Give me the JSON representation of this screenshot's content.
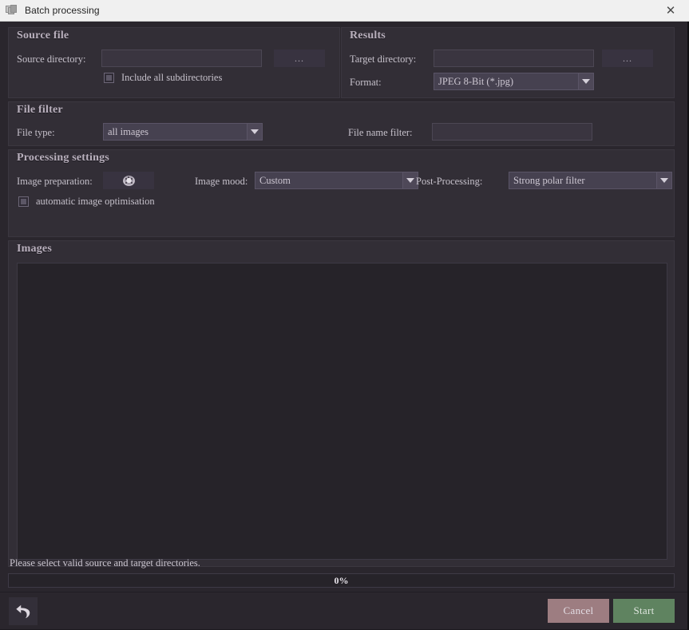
{
  "window": {
    "title": "Batch processing",
    "icon": "layers-icon",
    "close_label": "✕"
  },
  "source_file": {
    "title": "Source file",
    "source_directory_label": "Source directory:",
    "source_directory_value": "",
    "browse_label": "...",
    "include_subdirectories_label": "Include all subdirectories",
    "include_subdirectories_checked": false
  },
  "results": {
    "title": "Results",
    "target_directory_label": "Target directory:",
    "target_directory_value": "",
    "browse_label": "...",
    "format_label": "Format:",
    "format_value": "JPEG 8-Bit (*.jpg)"
  },
  "file_filter": {
    "title": "File filter",
    "file_type_label": "File type:",
    "file_type_value": "all images",
    "file_name_filter_label": "File name filter:",
    "file_name_filter_value": ""
  },
  "processing_settings": {
    "title": "Processing settings",
    "image_preparation_label": "Image preparation:",
    "image_preparation_icon": "gear-icon",
    "automatic_optimisation_label": "automatic image optimisation",
    "automatic_optimisation_checked": false,
    "image_mood_label": "Image mood:",
    "image_mood_value": "Custom",
    "post_processing_label": "Post-Processing:",
    "post_processing_value": "Strong polar filter"
  },
  "images": {
    "title": "Images",
    "items": []
  },
  "status": {
    "message": "Please select valid source and target directories.",
    "progress_percent": "0%"
  },
  "footer": {
    "back_icon": "undo-arrow-icon",
    "cancel_label": "Cancel",
    "start_label": "Start"
  },
  "colors": {
    "window_background": "#2a262d",
    "panel_background": "#322e36",
    "titlebar_background": "#f0f0f0",
    "cancel_button": "#9d7d81",
    "start_button": "#5f8360",
    "group_title_text": "#b9b0bd"
  }
}
